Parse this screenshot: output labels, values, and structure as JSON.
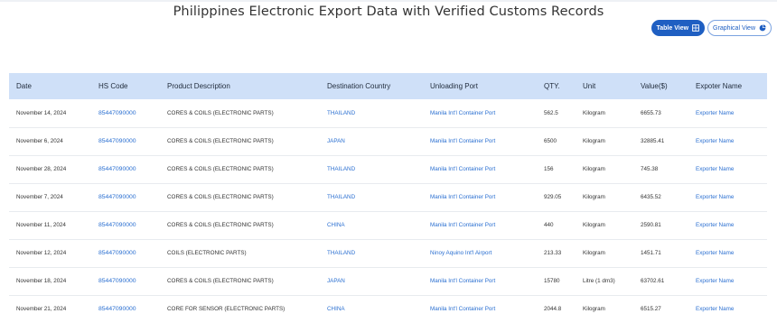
{
  "page": {
    "title": "Philippines Electronic Export Data with Verified Customs Records"
  },
  "view_toggle": {
    "table_label": "Table View",
    "graph_label": "Graphical View",
    "table_icon": "table-icon",
    "graph_icon": "pie-chart-icon"
  },
  "colors": {
    "accent": "#1f5fc2",
    "header_bg": "#cfe0f8",
    "link": "#2a6fd1"
  },
  "table": {
    "columns": [
      "Date",
      "HS Code",
      "Product Description",
      "Destination Country",
      "Unloading Port",
      "QTY.",
      "Unit",
      "Value($)",
      "Expoter Name"
    ],
    "rows": [
      [
        "November 14, 2024",
        "85447090000",
        "CORES & COILS (ELECTRONIC PARTS)",
        "THAILAND",
        "Manila Int'l Container Port",
        "562.5",
        "Kilogram",
        "6655.73",
        "Exporter Name"
      ],
      [
        "November 6, 2024",
        "85447090000",
        "CORES & COILS (ELECTRONIC PARTS)",
        "JAPAN",
        "Manila Int'l Container Port",
        "6500",
        "Kilogram",
        "32885.41",
        "Exporter Name"
      ],
      [
        "November 28, 2024",
        "85447090000",
        "CORES & COILS (ELECTRONIC PARTS)",
        "THAILAND",
        "Manila Int'l Container Port",
        "156",
        "Kilogram",
        "745.38",
        "Exporter Name"
      ],
      [
        "November 7, 2024",
        "85447090000",
        "CORES & COILS (ELECTRONIC PARTS)",
        "THAILAND",
        "Manila Int'l Container Port",
        "929.05",
        "Kilogram",
        "6435.52",
        "Exporter Name"
      ],
      [
        "November 11, 2024",
        "85447090000",
        "CORES & COILS (ELECTRONIC PARTS)",
        "CHINA",
        "Manila Int'l Container Port",
        "440",
        "Kilogram",
        "2590.81",
        "Exporter Name"
      ],
      [
        "November 12, 2024",
        "85447090000",
        "COILS (ELECTRONIC PARTS)",
        "THAILAND",
        "Ninoy Aquino Int'l Airport",
        "213.33",
        "Kilogram",
        "1451.71",
        "Exporter Name"
      ],
      [
        "November 18, 2024",
        "85447090000",
        "CORES & COILS (ELECTRONIC PARTS)",
        "JAPAN",
        "Manila Int'l Container Port",
        "15780",
        "Litre (1 dm3)",
        "63702.61",
        "Exporter Name"
      ],
      [
        "November 21, 2024",
        "85447090000",
        "CORE FOR SENSOR (ELECTRONIC PARTS)",
        "CHINA",
        "Manila Int'l Container Port",
        "2044.8",
        "Kilogram",
        "6515.27",
        "Exporter Name"
      ]
    ]
  }
}
